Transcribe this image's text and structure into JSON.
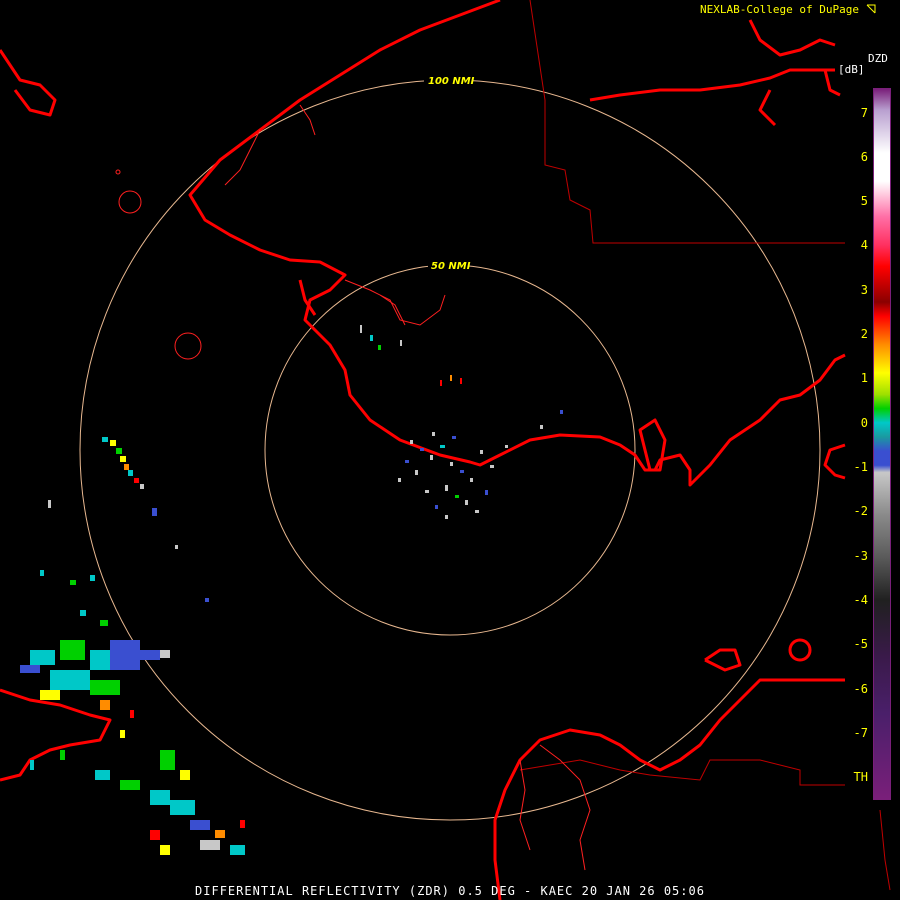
{
  "header": {
    "credit": "NEXLAB-College of DuPage"
  },
  "caption": {
    "text": "DIFFERENTIAL REFLECTIVITY (ZDR) 0.5 DEG - KAEC 20 JAN 26 05:06"
  },
  "rings": [
    {
      "label": "50 NMI",
      "range_nmi": 50
    },
    {
      "label": "100 NMI",
      "range_nmi": 100
    }
  ],
  "legend": {
    "product": "DZD",
    "units": "[dB]",
    "ticks": [
      "7",
      "6",
      "5",
      "4",
      "3",
      "2",
      "1",
      "0",
      "-1",
      "-2",
      "-3",
      "-4",
      "-5",
      "-6",
      "-7",
      "TH"
    ],
    "colors": {
      "top": "#7a1f7a",
      "white": "#ffffff",
      "pink": "#ff6fa6",
      "red": "#ff0000",
      "darkred": "#8a0000",
      "orange": "#ff8c00",
      "yellow": "#ffff00",
      "green": "#00d000",
      "cyan": "#00c8c8",
      "blue": "#3a4fd0",
      "gray": "#c8c8c8",
      "black": "#202020",
      "purple": "#4a1f6a"
    }
  },
  "colors": {
    "background": "#000000",
    "coastline": "#ff0000",
    "boundary": "#c00000",
    "ring": "#e8b890",
    "label": "#ffff00",
    "caption": "#ffffff"
  },
  "icons": {
    "external": "external-link-icon"
  }
}
